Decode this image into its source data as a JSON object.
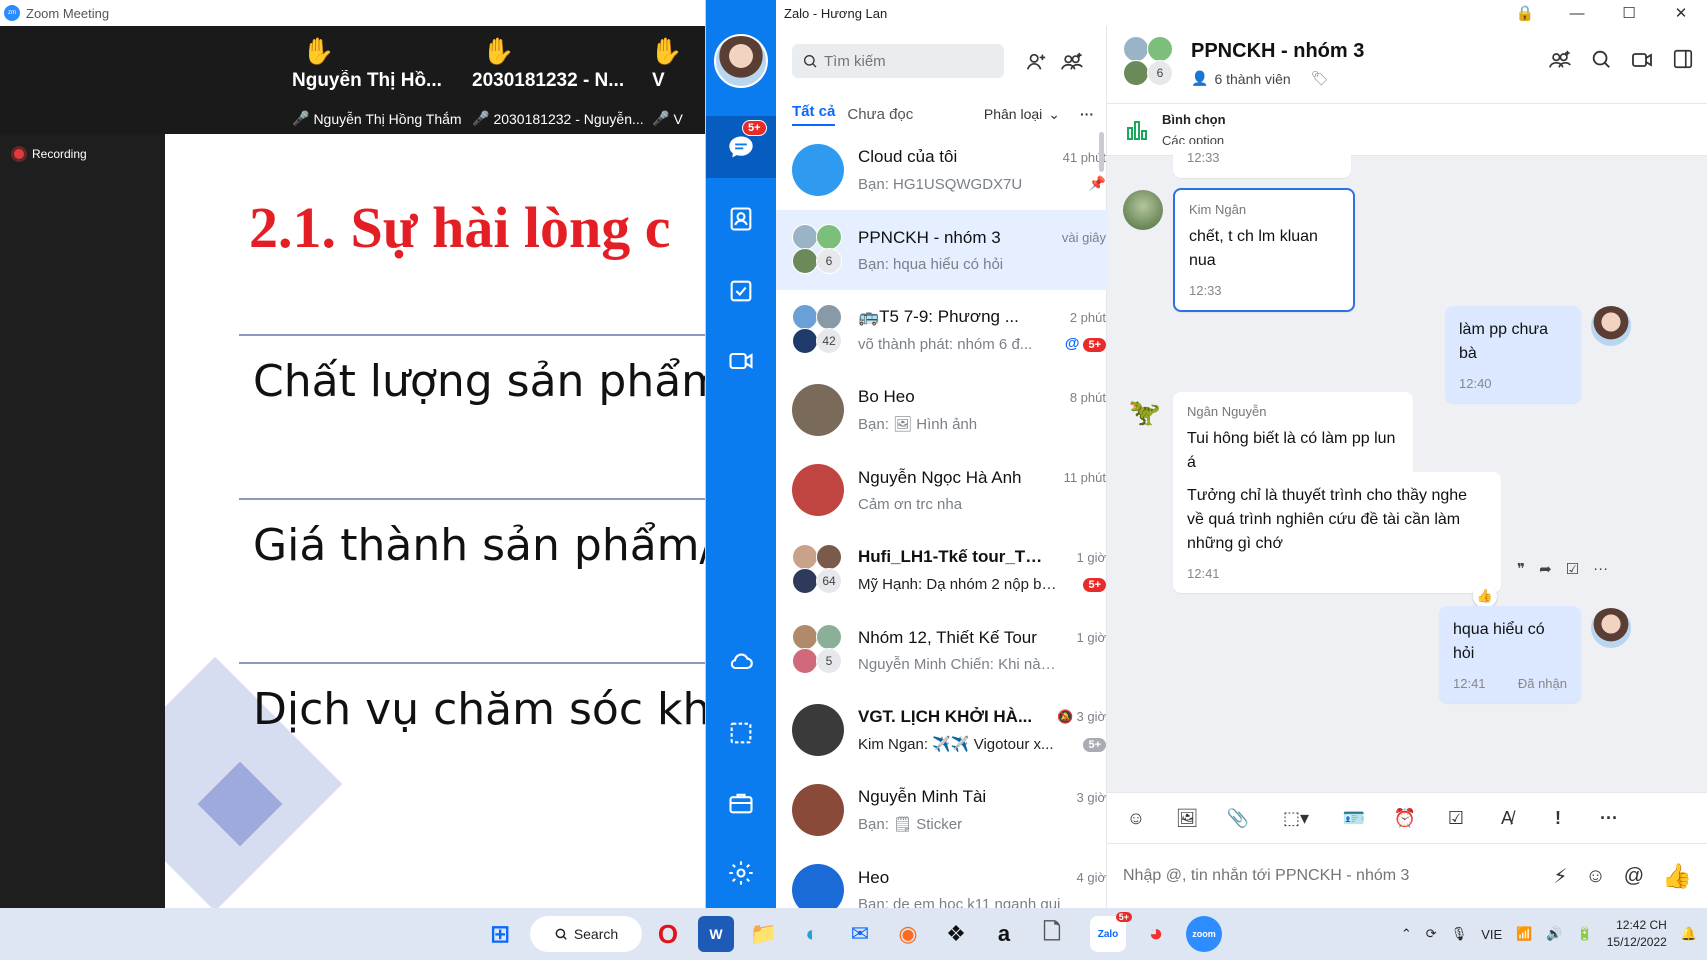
{
  "zoom": {
    "title": "Zoom Meeting",
    "recording": "Recording",
    "participants": [
      {
        "name": "Nguyễn Thị Hồ...",
        "sub": "Nguyễn Thị Hồng Thắm"
      },
      {
        "name": "2030181232 - N...",
        "sub": "2030181232 - Nguyễn..."
      },
      {
        "name": "V",
        "sub": "V"
      }
    ]
  },
  "slide": {
    "title": "2.1. Sự hài lòng c",
    "items": [
      "Chất lượng sản phẩm/",
      "Giá thành sản phẩm/d",
      "Dịch vụ chăm sóc khá"
    ]
  },
  "zalo": {
    "window_title": "Zalo - Hương Lan",
    "nav_badge": "5+",
    "search_placeholder": "Tìm kiếm",
    "tabs": {
      "all": "Tất cả",
      "unread": "Chưa đọc",
      "filter": "Phân loại"
    },
    "conversations": [
      {
        "name": "Cloud của tôi",
        "time": "41 phút",
        "msg": "Bạn: HG1USQWGDX7U",
        "badge": "",
        "pinned": true,
        "avatar_color": "#2f9bf0"
      },
      {
        "name": "PPNCKH - nhóm 3",
        "time": "vài giây",
        "msg": "Bạn: hqua hiểu có hỏi",
        "badge": "",
        "group_count": "6"
      },
      {
        "name": "🚌T5 7-9: Phương ...",
        "time": "2 phút",
        "msg": "võ thành phát: nhóm 6 đ...",
        "badge": "5+",
        "group_count": "42",
        "mention": "@"
      },
      {
        "name": "Bo Heo",
        "time": "8 phút",
        "msg": "Bạn: 🖼 Hình ảnh",
        "badge": "",
        "avatar_color": "#7a6a5a"
      },
      {
        "name": "Nguyễn Ngọc Hà Anh",
        "time": "11 phút",
        "msg": "Cảm ơn trc nha",
        "badge": "",
        "avatar_color": "#c0443f"
      },
      {
        "name": "Hufi_LH1-Tkế tour_Th...",
        "time": "1 giờ",
        "msg": "Mỹ Hạnh: Dạ nhóm 2 nộp bài...",
        "badge": "5+",
        "group_count": "64",
        "bold": true
      },
      {
        "name": "Nhóm 12, Thiết Kế Tour",
        "time": "1 giờ",
        "msg": "Nguyễn Minh Chiến: Khi nào b...",
        "badge": "",
        "group_count": "5"
      },
      {
        "name": "VGT. LỊCH KHỞI HÀ...",
        "time": "3 giờ",
        "msg": "Kim Ngan: ✈️✈️ Vigotour x...",
        "badge": "5+",
        "badge_gray": true,
        "avatar_color": "#3a3a3a",
        "bold": true,
        "muted": true
      },
      {
        "name": "Nguyễn Minh Tài",
        "time": "3 giờ",
        "msg": "Bạn: 🗒 Sticker",
        "badge": "",
        "avatar_color": "#8a4a3a"
      },
      {
        "name": "Heo",
        "time": "4 giờ",
        "msg": "Bạn: de em hoc k11 nganh gui",
        "badge": "",
        "avatar_color": "#1a6ad8"
      }
    ],
    "chat": {
      "title": "PPNCKH - nhóm 3",
      "members": "6 thành viên",
      "group_count": "6",
      "poll_title": "Bình chọn",
      "poll_sub": "Các option",
      "messages": [
        {
          "sender": "",
          "text": "",
          "time": "12:33",
          "me": false
        },
        {
          "sender": "Kim Ngân",
          "text": "chết, t ch lm kluan nua",
          "time": "12:33",
          "me": false
        },
        {
          "sender": "",
          "text": "làm pp chưa bà",
          "time": "12:40",
          "me": true
        },
        {
          "sender": "Ngân Nguyễn",
          "text": "Tui hông biết là có làm pp lun á",
          "time": "",
          "me": false
        },
        {
          "sender": "",
          "text": "Tưởng chỉ là thuyết trình cho thầy nghe về quá trình nghiên cứu đề tài cần làm những gì chớ",
          "time": "12:41",
          "me": false
        },
        {
          "sender": "",
          "text": "hqua hiểu có hỏi",
          "time": "12:41",
          "status": "Đã nhận",
          "me": true
        }
      ],
      "compose_placeholder": "Nhập @, tin nhắn tới PPNCKH - nhóm 3"
    }
  },
  "taskbar": {
    "search": "Search",
    "lang": "VIE",
    "time": "12:42 CH",
    "date": "15/12/2022",
    "zalo_badge": "5+"
  },
  "colors": {
    "zalo_blue": "#0a7cf0",
    "red": "#e31e24"
  }
}
